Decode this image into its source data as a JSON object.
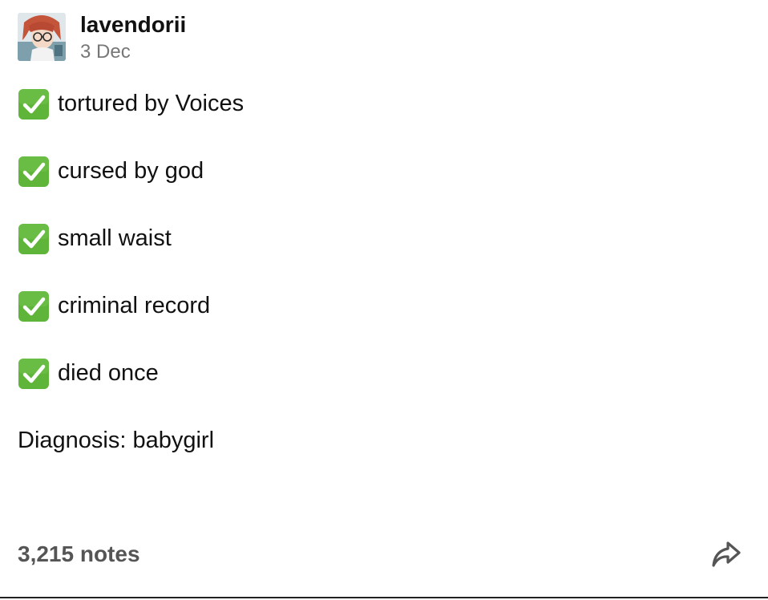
{
  "post": {
    "author": {
      "username": "lavendorii",
      "avatar_icon": "avatar-icon"
    },
    "date": "3 Dec",
    "items": [
      {
        "icon": "check-mark-button-icon",
        "text": "tortured by Voices"
      },
      {
        "icon": "check-mark-button-icon",
        "text": "cursed by god"
      },
      {
        "icon": "check-mark-button-icon",
        "text": "small waist"
      },
      {
        "icon": "check-mark-button-icon",
        "text": "criminal record"
      },
      {
        "icon": "check-mark-button-icon",
        "text": "died once"
      }
    ],
    "diagnosis": "Diagnosis: babygirl",
    "notes": "3,215 notes",
    "share_icon": "share-icon"
  },
  "colors": {
    "check_green": "#5fb53a",
    "text": "#111111",
    "muted": "#777777",
    "notes": "#555555"
  }
}
